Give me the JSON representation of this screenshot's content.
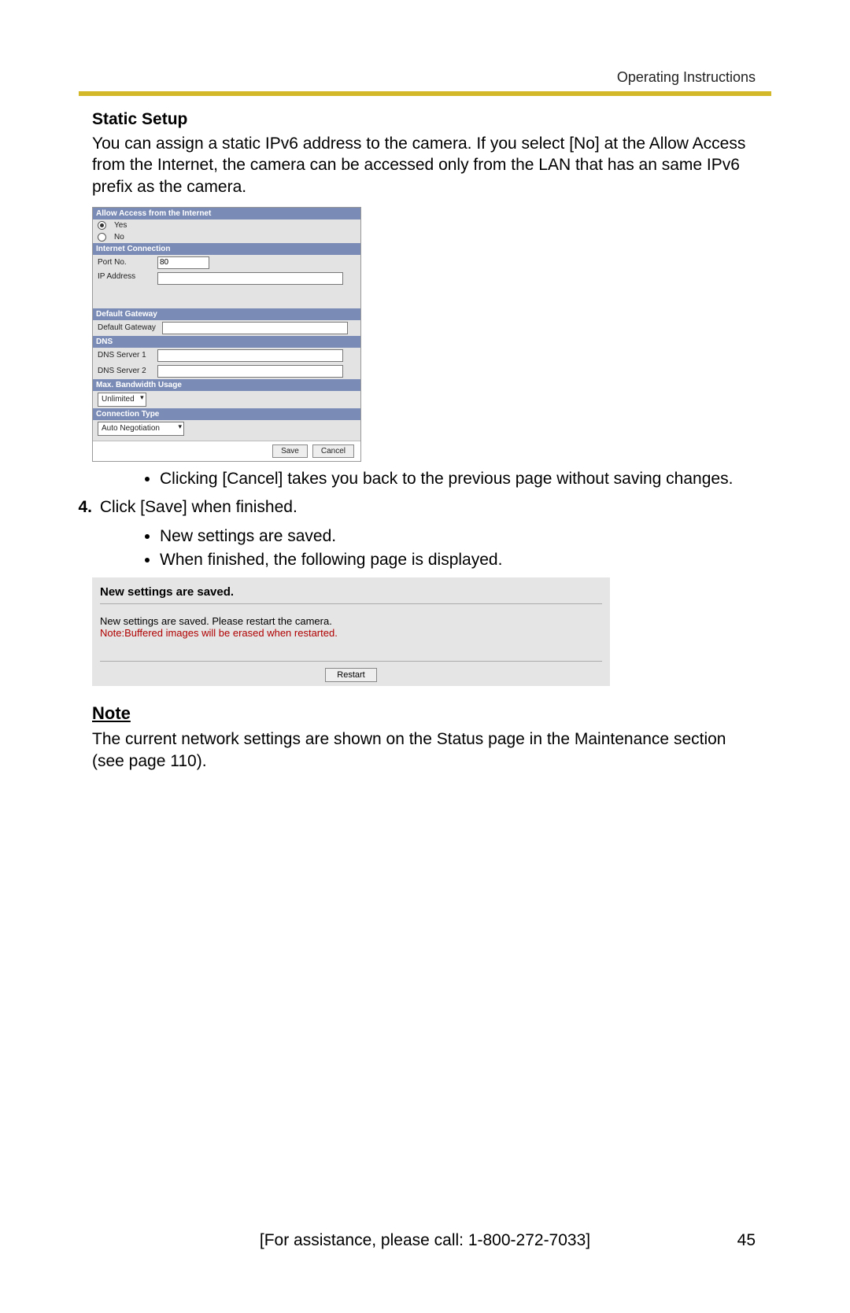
{
  "header": {
    "running_head": "Operating Instructions"
  },
  "section": {
    "title": "Static Setup",
    "intro": "You can assign a static IPv6 address to the camera. If you select [No] at the Allow Access from the Internet, the camera can be accessed only from the LAN that has an same IPv6 prefix as the camera."
  },
  "config_panel": {
    "allow_access_header": "Allow Access from the Internet",
    "yes": "Yes",
    "no": "No",
    "internet_connection_header": "Internet Connection",
    "port_no_label": "Port No.",
    "port_no_value": "80",
    "ip_address_label": "IP Address",
    "ip_address_value": "",
    "default_gateway_header": "Default Gateway",
    "default_gateway_label": "Default Gateway",
    "default_gateway_value": "",
    "dns_header": "DNS",
    "dns1_label": "DNS Server 1",
    "dns1_value": "",
    "dns2_label": "DNS Server 2",
    "dns2_value": "",
    "max_bw_header": "Max. Bandwidth Usage",
    "max_bw_value": "Unlimited",
    "conn_type_header": "Connection Type",
    "conn_type_value": "Auto Negotiation",
    "save": "Save",
    "cancel": "Cancel"
  },
  "bullets": {
    "cancel_note": "Clicking [Cancel] takes you back to the previous page without saving changes.",
    "saved": "New settings are saved.",
    "following_page": "When finished, the following page is displayed."
  },
  "step": {
    "number": "4.",
    "text": "Click [Save] when finished."
  },
  "saved_dialog": {
    "title": "New settings are saved.",
    "line1": "New settings are saved. Please restart the camera.",
    "line2": "Note:Buffered images will be erased when restarted.",
    "restart": "Restart"
  },
  "note": {
    "heading": "Note",
    "text": "The current network settings are shown on the Status page in the Maintenance section (see page 110)."
  },
  "footer": {
    "assistance": "[For assistance, please call: 1-800-272-7033]",
    "page_number": "45"
  }
}
